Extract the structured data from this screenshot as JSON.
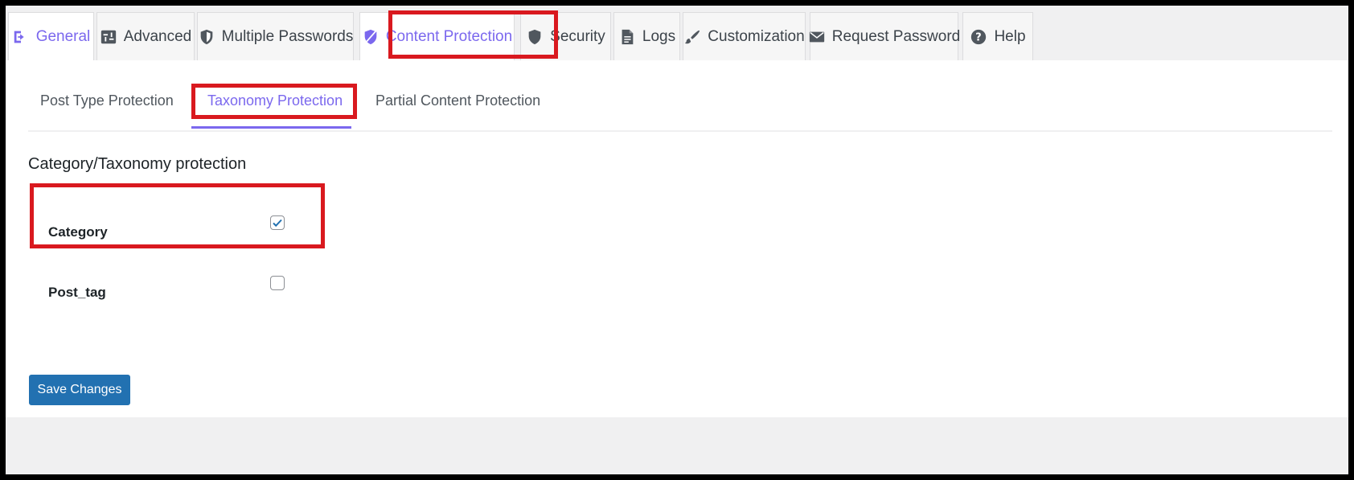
{
  "tabs": [
    {
      "label": "General",
      "icon": "sign-in-icon",
      "active": false
    },
    {
      "label": "Advanced",
      "icon": "sliders-icon",
      "active": false
    },
    {
      "label": "Multiple Passwords",
      "icon": "shield-half-icon",
      "active": false
    },
    {
      "label": "Content Protection",
      "icon": "shield-slash-icon",
      "active": true
    },
    {
      "label": "Security",
      "icon": "shield-icon",
      "active": false
    },
    {
      "label": "Logs",
      "icon": "document-icon",
      "active": false
    },
    {
      "label": "Customization",
      "icon": "brush-icon",
      "active": false
    },
    {
      "label": "Request Password",
      "icon": "envelope-icon",
      "active": false
    },
    {
      "label": "Help",
      "icon": "question-circle-icon",
      "active": false
    }
  ],
  "subtabs": [
    {
      "label": "Post Type Protection",
      "active": false
    },
    {
      "label": "Taxonomy Protection",
      "active": true
    },
    {
      "label": "Partial Content Protection",
      "active": false
    }
  ],
  "section": {
    "title": "Category/Taxonomy protection",
    "rows": [
      {
        "label": "Category",
        "checked": true
      },
      {
        "label": "Post_tag",
        "checked": false
      }
    ]
  },
  "actions": {
    "save_label": "Save Changes"
  },
  "colors": {
    "accent": "#7b68ee",
    "button": "#2271b1",
    "highlight": "#d9191f"
  }
}
